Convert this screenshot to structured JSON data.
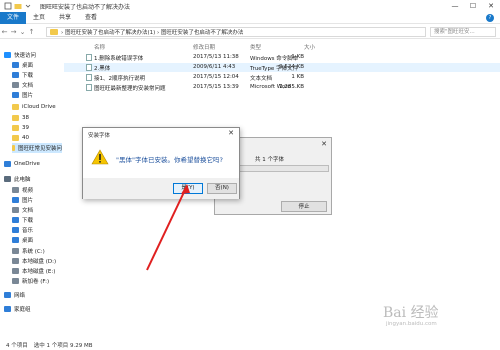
{
  "window": {
    "title": "图旺旺安装了也启动不了解决办法",
    "minimize": "—",
    "maximize": "☐",
    "close": "✕"
  },
  "ribbon": {
    "tabs": [
      "文件",
      "主页",
      "共享",
      "查看"
    ],
    "help": "?"
  },
  "address": {
    "path": "› 图旺旺安装了也启动不了解决办法(1) › 图旺旺安装了也启动不了解决办法",
    "search_placeholder": "搜索\"图旺旺安..."
  },
  "sidebar": {
    "items": [
      {
        "label": "快速访问",
        "color": "#1e90ff"
      },
      {
        "label": "桌面",
        "color": "#2f7ed8"
      },
      {
        "label": "下载",
        "color": "#2f7ed8"
      },
      {
        "label": "文档",
        "color": "#7a8896"
      },
      {
        "label": "图片",
        "color": "#2f7ed8"
      },
      {
        "label": "iCloud Drive",
        "color": "#f2c94c"
      },
      {
        "label": "38",
        "color": "#f2c94c"
      },
      {
        "label": "39",
        "color": "#f2c94c"
      },
      {
        "label": "40",
        "color": "#f2c94c"
      },
      {
        "label": "图旺旺常见安装问",
        "color": "#f2c94c"
      },
      {
        "label": "OneDrive",
        "color": "#2f7ed8"
      },
      {
        "label": "此电脑",
        "color": "#5a6b7c"
      },
      {
        "label": "视频",
        "color": "#7a8896"
      },
      {
        "label": "图片",
        "color": "#2f7ed8"
      },
      {
        "label": "文档",
        "color": "#7a8896"
      },
      {
        "label": "下载",
        "color": "#2f7ed8"
      },
      {
        "label": "音乐",
        "color": "#2f7ed8"
      },
      {
        "label": "桌面",
        "color": "#2f7ed8"
      },
      {
        "label": "系统 (C:)",
        "color": "#7a8896"
      },
      {
        "label": "本地磁盘 (D:)",
        "color": "#7a8896"
      },
      {
        "label": "本地磁盘 (E:)",
        "color": "#7a8896"
      },
      {
        "label": "新加卷 (F:)",
        "color": "#7a8896"
      },
      {
        "label": "网络",
        "color": "#2f7ed8"
      },
      {
        "label": "家庭组",
        "color": "#2f7ed8"
      }
    ]
  },
  "columns": [
    "名称",
    "修改日期",
    "类型",
    "大小"
  ],
  "files": [
    {
      "name": "1.删除系统错误字体",
      "date": "2017/5/13 11:38",
      "type": "Windows 命令脚本",
      "size": "1 KB"
    },
    {
      "name": "2.黑体",
      "date": "2009/6/11 4:43",
      "type": "TrueType 字体文件",
      "size": "9,524 KB"
    },
    {
      "name": "接1、2顺序执行说明",
      "date": "2017/5/15 12:04",
      "type": "文本文档",
      "size": "1 KB"
    },
    {
      "name": "图旺旺最新整理的安装常问题",
      "date": "2017/5/15 13:39",
      "type": "Microsoft Word ...",
      "size": "1,285 KB"
    }
  ],
  "status": {
    "count": "4 个项目",
    "selection": "选中 1 个项目  9.29 MB"
  },
  "install_dialog": {
    "title": "安装字体",
    "message": "\"黑体\"字体已安装。你希望替换它吗?",
    "yes": "是(Y)",
    "no": "否(N)",
    "close": "✕"
  },
  "background_dialog": {
    "close": "✕",
    "progress_text": "共 1 个字体",
    "stop": "停止"
  },
  "watermark": {
    "text": "Bai 经验",
    "sub": "jingyan.baidu.com"
  },
  "colors": {
    "accent": "#1979ca",
    "selected_row": "#e5f3ff",
    "arrow": "#e02020",
    "warning": "#f5c400"
  }
}
